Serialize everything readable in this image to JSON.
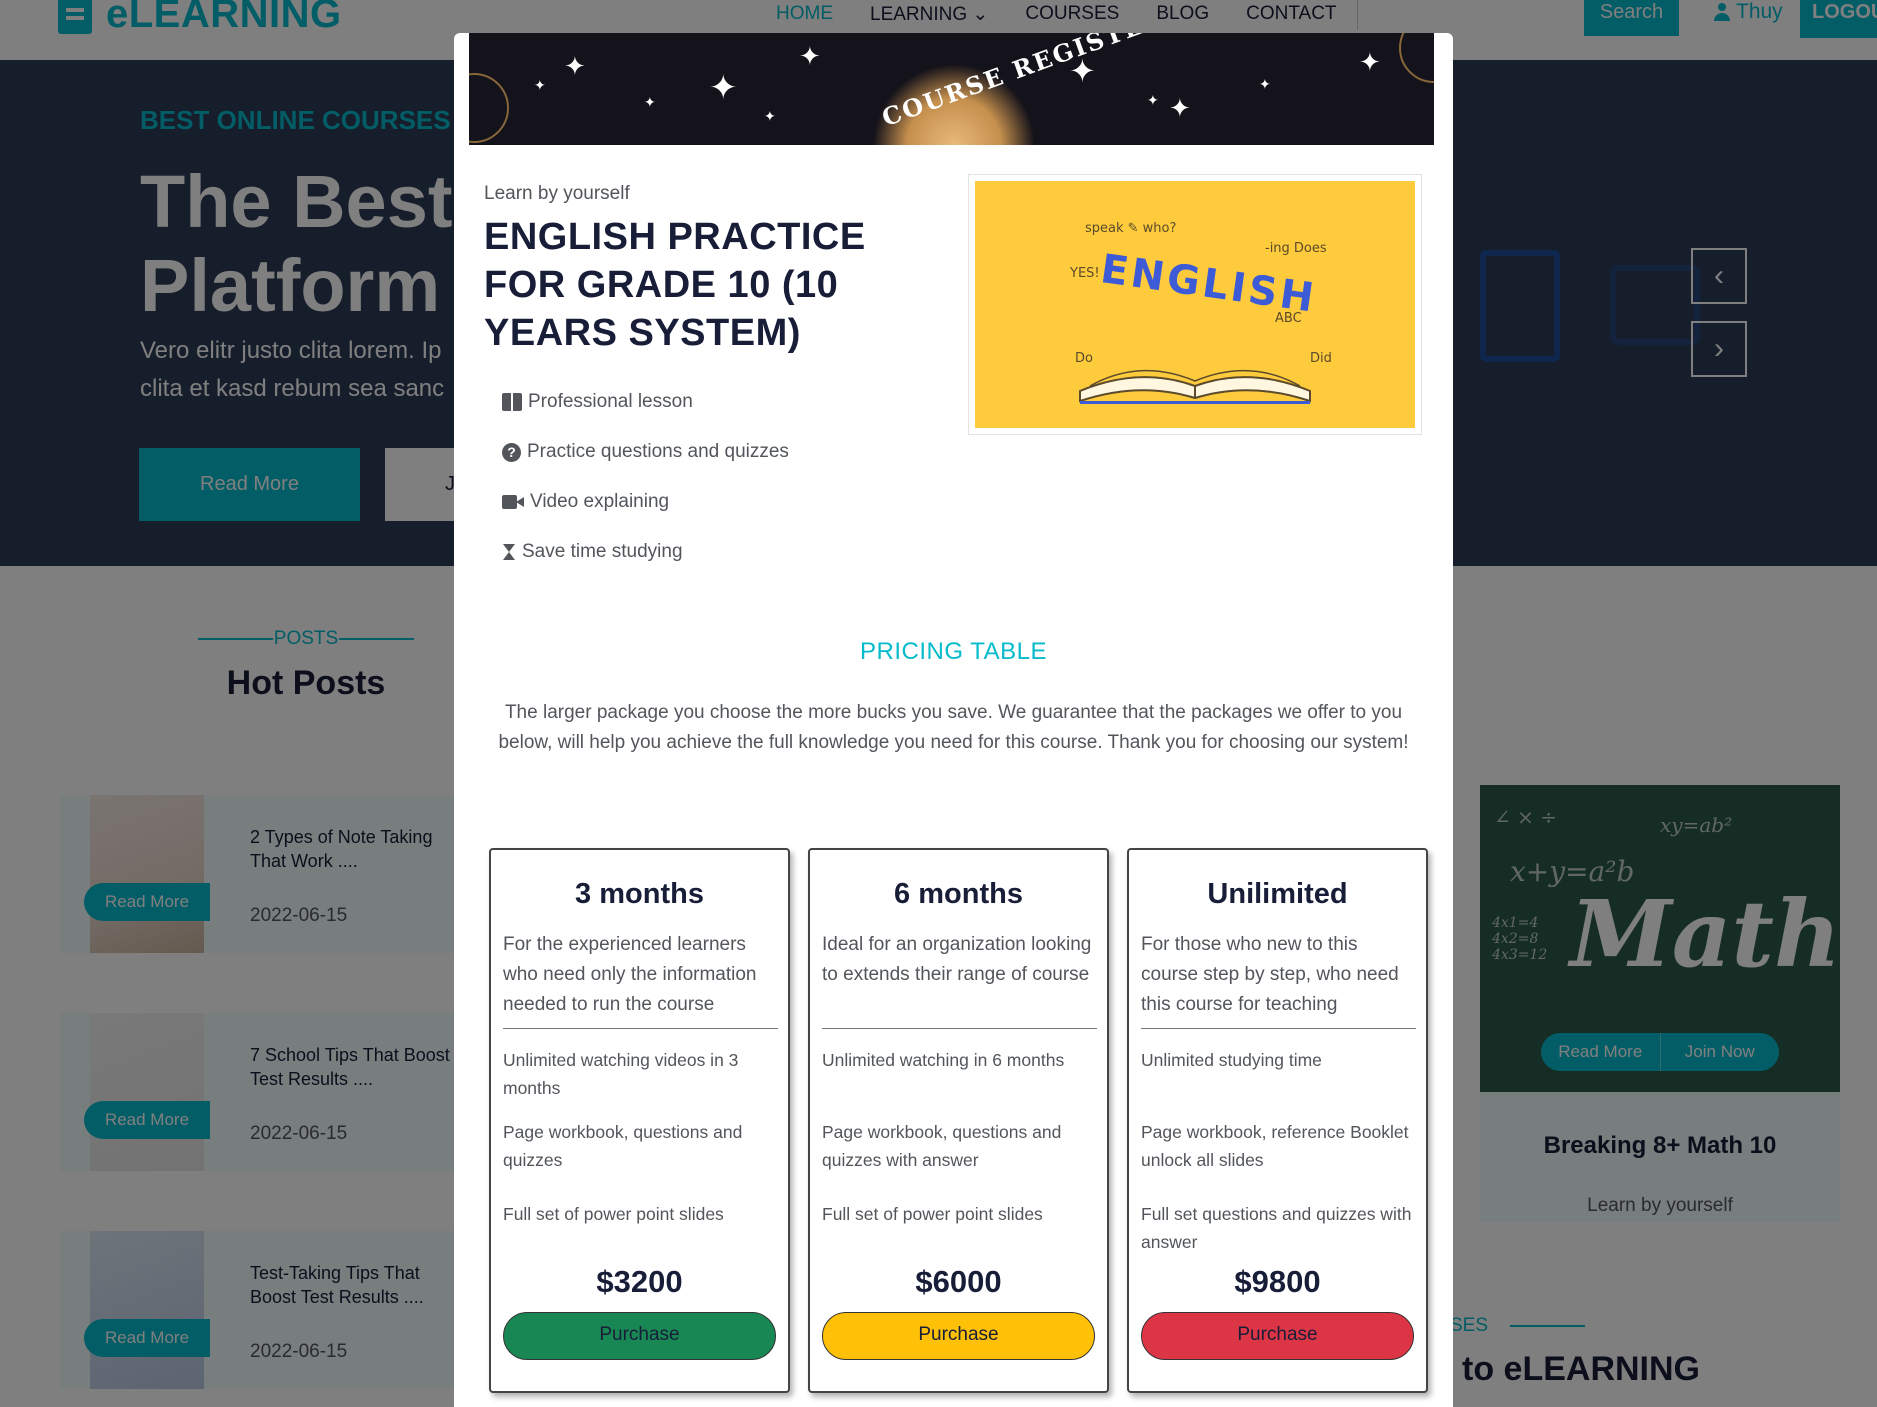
{
  "nav": {
    "brand": "eLEARNING",
    "links": [
      "HOME",
      "LEARNING",
      "COURSES",
      "BLOG",
      "CONTACT"
    ],
    "search_label": "Search",
    "user_name": "Thuy",
    "logout_label": "LOGOUT"
  },
  "hero": {
    "eyebrow": "BEST ONLINE COURSES",
    "title": "The Best Platform",
    "subtitle": "Vero elitr justo clita lorem. Ip clita et kasd rebum sea sanc",
    "read_more": "Read More",
    "join_now": "J"
  },
  "posts_section": {
    "eyebrow": "POSTS",
    "title": "Hot Posts",
    "read_more": "Read More",
    "items": [
      {
        "title": "2 Types of Note Taking That Work ....",
        "date": "2022-06-15"
      },
      {
        "title": "7 School Tips That Boost Test Results ....",
        "date": "2022-06-15"
      },
      {
        "title": "Test-Taking Tips That Boost Test Results ....",
        "date": "2022-06-15"
      }
    ]
  },
  "course_card": {
    "read_more": "Read More",
    "join_now": "Join Now",
    "title": "Breaking 8+ Math 10",
    "subtitle": "Learn by yourself",
    "image_word": "Math"
  },
  "courses_section": {
    "eyebrow": "SES",
    "title": "to eLEARNING"
  },
  "modal": {
    "banner_text": "COURSE REGISTER",
    "eyebrow": "Learn by yourself",
    "title": "ENGLISH PRACTICE FOR GRADE 10 (10 YEARS SYSTEM)",
    "image_word": "ENGLISH",
    "features": [
      {
        "icon": "book-open-icon",
        "label": "Professional lesson"
      },
      {
        "icon": "question-circle-icon",
        "label": "Practice questions and quizzes"
      },
      {
        "icon": "video-icon",
        "label": "Video explaining"
      },
      {
        "icon": "hourglass-icon",
        "label": "Save time studying"
      }
    ],
    "pricing": {
      "title": "PRICING TABLE",
      "description": "The larger package you choose the more bucks you save. We guarantee that the packages we offer to you below, will help you achieve the full knowledge you need for this course. Thank you for choosing our system!",
      "plans": [
        {
          "name": "3 months",
          "description": "For the experienced learners who need only the information needed to run the course",
          "features": [
            "Unlimited watching videos in 3 months",
            "Page workbook, questions and quizzes",
            "Full set of power point slides"
          ],
          "price": "$3200",
          "button": "Purchase",
          "button_color": "#198754"
        },
        {
          "name": "6 months",
          "description": "Ideal for an organization looking to extends their range of course",
          "features": [
            "Unlimited watching in 6 months",
            "Page workbook, questions and quizzes with answer",
            "Full set of power point slides"
          ],
          "price": "$6000",
          "button": "Purchase",
          "button_color": "#ffc107"
        },
        {
          "name": "Unilimited",
          "description": "For those who new to this course step by step, who need this course for teaching",
          "features": [
            "Unlimited studying time",
            "Page workbook, reference Booklet unlock all slides",
            "Full set questions and quizzes with answer"
          ],
          "price": "$9800",
          "button": "Purchase",
          "button_color": "#dc3545"
        }
      ]
    }
  },
  "colors": {
    "accent": "#06BBCC",
    "dark": "#181d38",
    "overlay": "rgba(0,0,0,0.5)"
  }
}
